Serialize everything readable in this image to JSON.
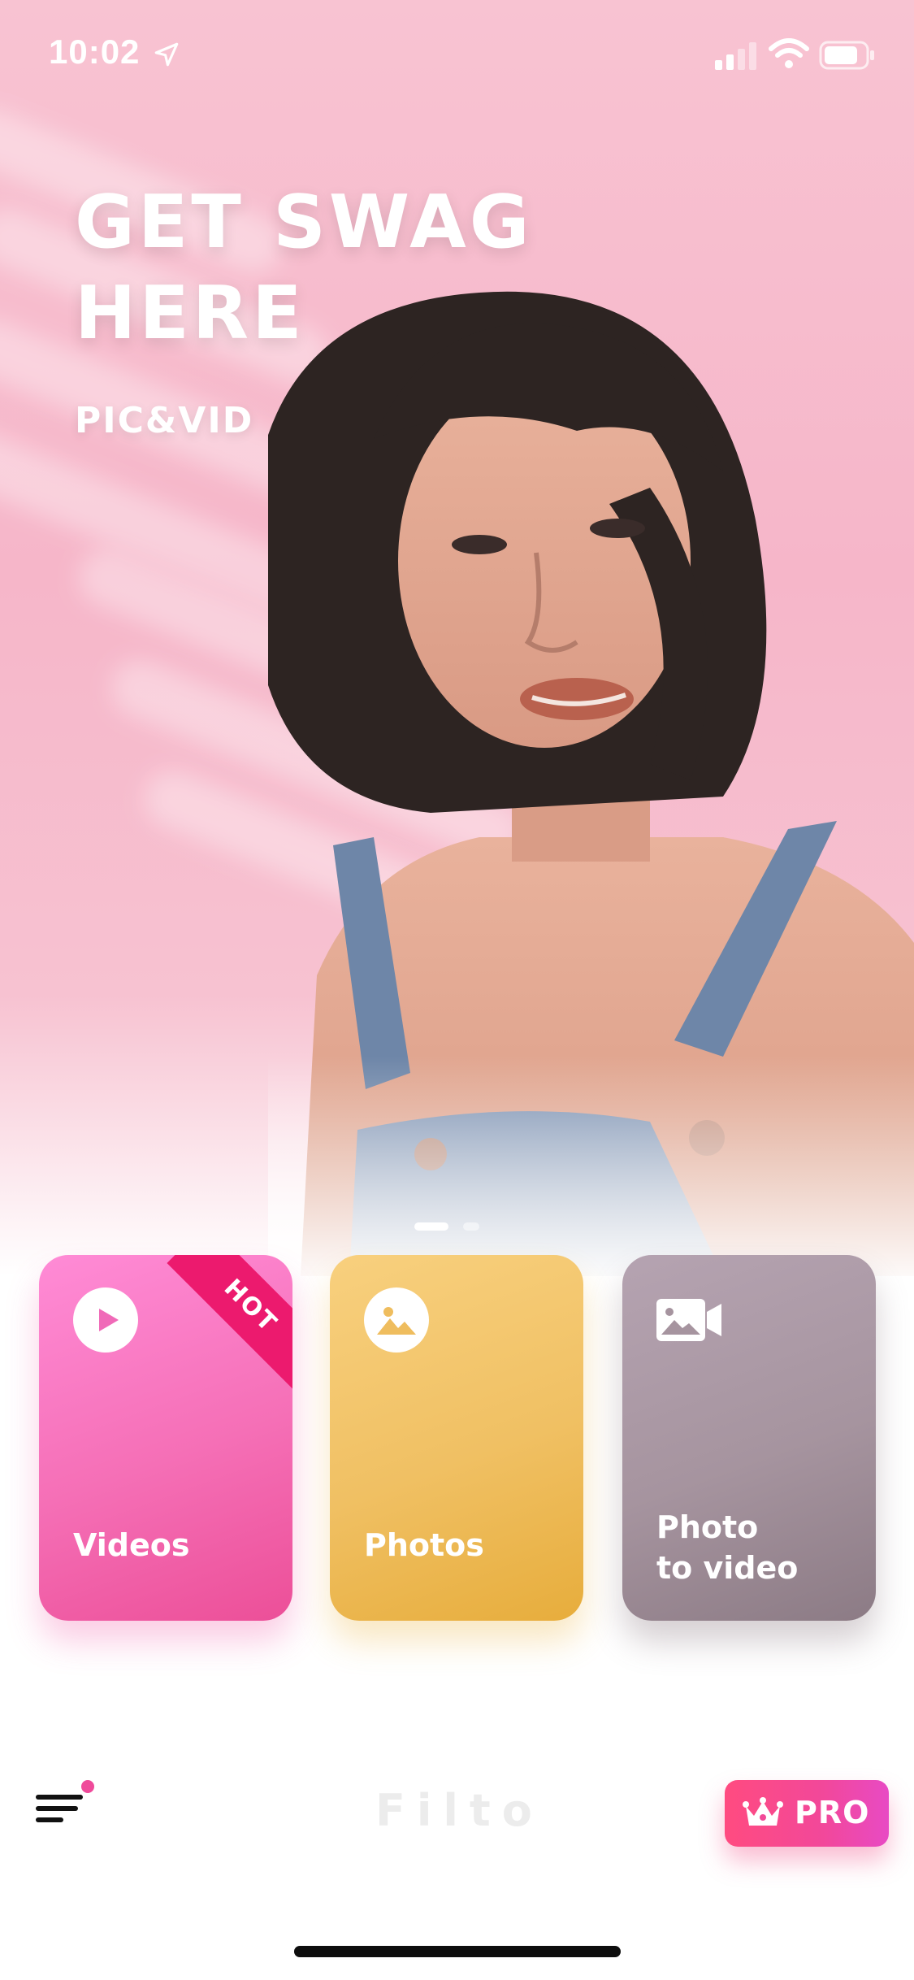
{
  "status_bar": {
    "time": "10:02"
  },
  "hero": {
    "headline_line1": "GET SWAG",
    "headline_line2": "HERE",
    "subtitle": "PIC&VID",
    "page_indicator": {
      "total": 2,
      "active": 1
    }
  },
  "cards": [
    {
      "label": "Videos",
      "icon": "play-icon",
      "badge": "HOT",
      "color": "#f56fb6"
    },
    {
      "label": "Photos",
      "icon": "image-icon",
      "color": "#f0c063"
    },
    {
      "label": "Photo\nto video",
      "icon": "photo-video-icon",
      "color": "#a6949f"
    }
  ],
  "bottom_bar": {
    "menu_icon": "menu-icon",
    "brand": "Filto",
    "pro_label": "PRO",
    "pro_icon": "crown-icon"
  },
  "colors": {
    "hero_pink": "#f6b6c9",
    "accent_pink": "#ef4a9a",
    "hot_badge": "#ec1a6e"
  }
}
